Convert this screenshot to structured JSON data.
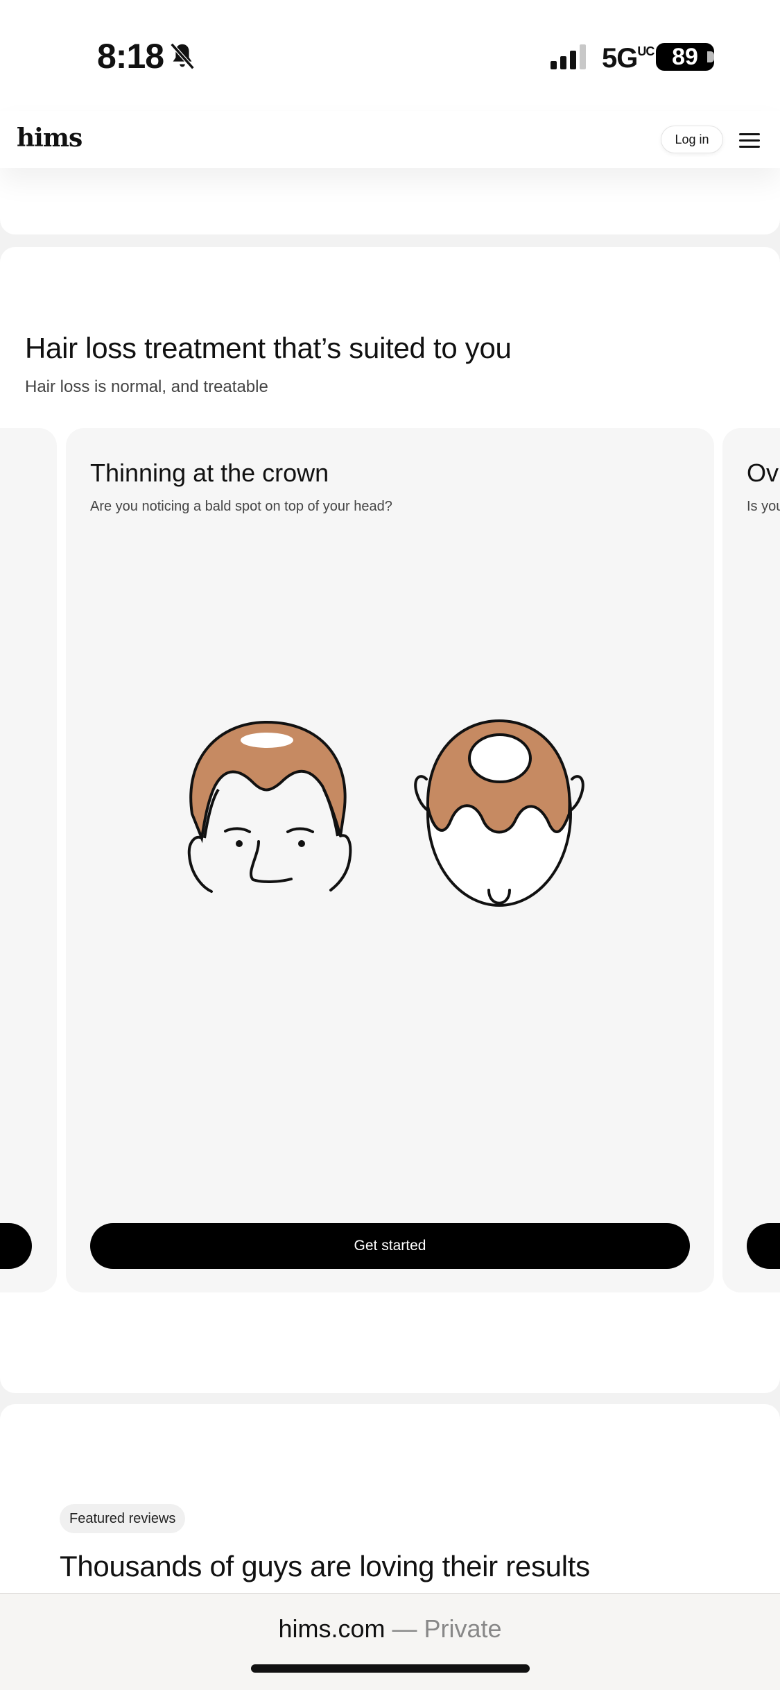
{
  "status_bar": {
    "time": "8:18",
    "network": "5G",
    "network_badge": "UC",
    "battery": "89",
    "icons": [
      "bell-muted-icon",
      "signal-icon",
      "battery-icon"
    ]
  },
  "header": {
    "logo": "hims",
    "login_label": "Log in",
    "menu_icon": "hamburger-menu-icon"
  },
  "section": {
    "title": "Hair loss treatment that’s suited to you",
    "subtitle": "Hair loss is normal, and treatable"
  },
  "carousel": {
    "main_card": {
      "title": "Thinning at the crown",
      "subtitle": "Are you noticing a bald spot on top of your head?",
      "cta": "Get started",
      "illustration": "crown-thinning-illustration"
    },
    "next_card": {
      "title_partial": "Ov",
      "subtitle_partial": "Is you"
    }
  },
  "reviews": {
    "badge": "Featured reviews",
    "title": "Thousands of guys are loving their results"
  },
  "browser": {
    "domain": "hims.com",
    "mode": "— Private"
  },
  "colors": {
    "hair": "#C68A62",
    "button": "#000000",
    "card_bg": "#F6F6F6"
  }
}
